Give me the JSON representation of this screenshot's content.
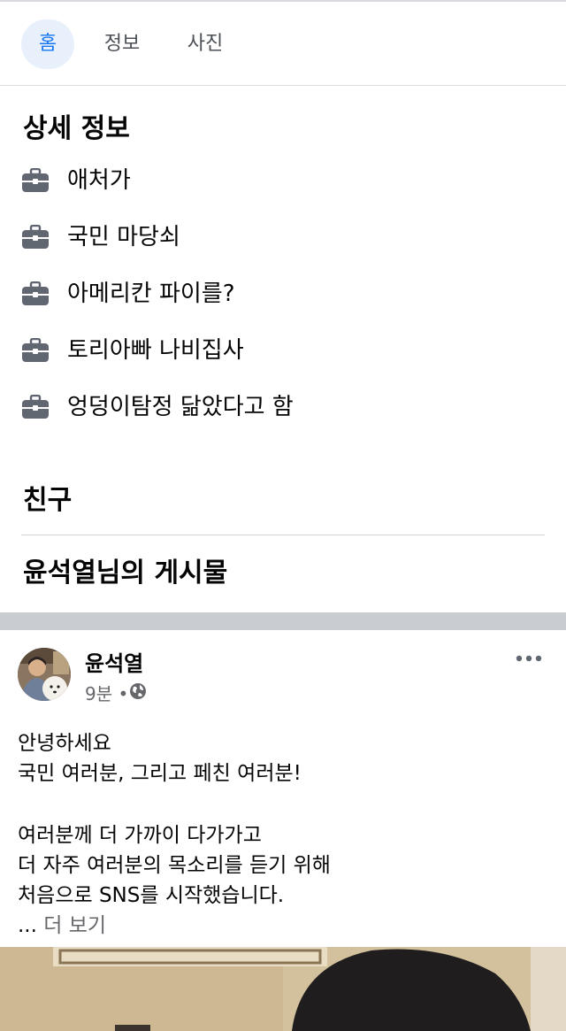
{
  "tabs": [
    {
      "label": "홈",
      "active": true
    },
    {
      "label": "정보",
      "active": false
    },
    {
      "label": "사진",
      "active": false
    }
  ],
  "details": {
    "title": "상세 정보",
    "items": [
      {
        "icon": "briefcase-icon",
        "text": "애처가"
      },
      {
        "icon": "briefcase-icon",
        "text": "국민 마당쇠"
      },
      {
        "icon": "briefcase-icon",
        "text": "아메리칸 파이를?"
      },
      {
        "icon": "briefcase-icon",
        "text": "토리아빠 나비집사"
      },
      {
        "icon": "briefcase-icon",
        "text": "엉덩이탐정 닮았다고 함"
      }
    ]
  },
  "friends": {
    "title": "친구"
  },
  "posts_section": {
    "title": "윤석열님의 게시물"
  },
  "post": {
    "author": "윤석열",
    "time": "9분",
    "separator": "•",
    "audience_icon": "globe-icon",
    "more_icon": "more-options-icon",
    "lines": [
      "안녕하세요",
      "국민 여러분, 그리고 페친 여러분!",
      "",
      "여러분께 더 가까이 다가가고",
      "더 자주 여러분의 목소리를 듣기 위해",
      "처음으로 SNS를 시작했습니다."
    ],
    "ellipsis": "...",
    "see_more": "더 보기"
  },
  "colors": {
    "accent": "#1877f2",
    "active_tab_bg": "#e7f0fb",
    "divider": "#dadde1",
    "band": "#c9ccd1",
    "secondary_text": "#65676b"
  }
}
